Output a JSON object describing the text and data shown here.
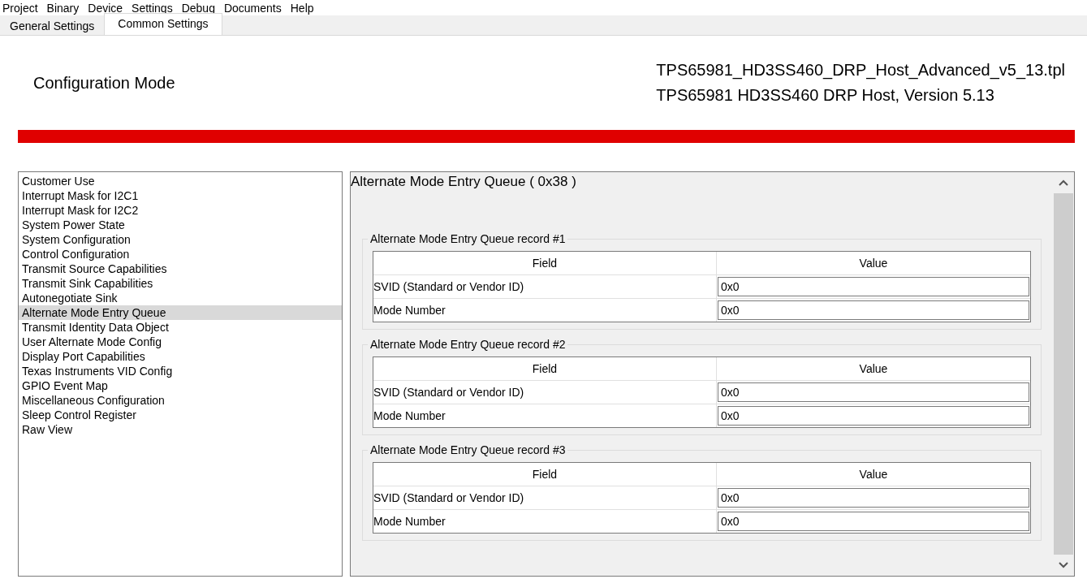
{
  "menu": [
    "Project",
    "Binary",
    "Device",
    "Settings",
    "Debug",
    "Documents",
    "Help"
  ],
  "tabs": [
    {
      "label": "General Settings",
      "selected": false
    },
    {
      "label": "Common Settings",
      "selected": true
    }
  ],
  "header": {
    "mode": "Configuration Mode",
    "file": "TPS65981_HD3SS460_DRP_Host_Advanced_v5_13.tpl",
    "description": "TPS65981 HD3SS460 DRP Host, Version 5.13"
  },
  "sidebar": {
    "items": [
      {
        "label": "Customer Use",
        "selected": false
      },
      {
        "label": "Interrupt Mask for I2C1",
        "selected": false
      },
      {
        "label": "Interrupt Mask for I2C2",
        "selected": false
      },
      {
        "label": "System Power State",
        "selected": false
      },
      {
        "label": "System Configuration",
        "selected": false
      },
      {
        "label": "Control Configuration",
        "selected": false
      },
      {
        "label": "Transmit Source Capabilities",
        "selected": false
      },
      {
        "label": "Transmit Sink Capabilities",
        "selected": false
      },
      {
        "label": "Autonegotiate Sink",
        "selected": false
      },
      {
        "label": "Alternate Mode Entry Queue",
        "selected": true
      },
      {
        "label": "Transmit Identity Data Object",
        "selected": false
      },
      {
        "label": "User Alternate Mode Config",
        "selected": false
      },
      {
        "label": "Display Port Capabilities",
        "selected": false
      },
      {
        "label": "Texas Instruments VID Config",
        "selected": false
      },
      {
        "label": "GPIO Event Map",
        "selected": false
      },
      {
        "label": "Miscellaneous Configuration",
        "selected": false
      },
      {
        "label": "Sleep Control Register",
        "selected": false
      },
      {
        "label": "Raw View",
        "selected": false
      }
    ]
  },
  "panel": {
    "title": "Alternate Mode Entry Queue  ( 0x38 )",
    "records": [
      {
        "title": "Alternate Mode Entry Queue record #1",
        "columns": [
          "Field",
          "Value"
        ],
        "rows": [
          {
            "field": "SVID (Standard or Vendor ID)",
            "value": "0x0"
          },
          {
            "field": "Mode Number",
            "value": "0x0"
          }
        ]
      },
      {
        "title": "Alternate Mode Entry Queue record #2",
        "columns": [
          "Field",
          "Value"
        ],
        "rows": [
          {
            "field": "SVID (Standard or Vendor ID)",
            "value": "0x0"
          },
          {
            "field": "Mode Number",
            "value": "0x0"
          }
        ]
      },
      {
        "title": "Alternate Mode Entry Queue record #3",
        "columns": [
          "Field",
          "Value"
        ],
        "rows": [
          {
            "field": "SVID (Standard or Vendor ID)",
            "value": "0x0"
          },
          {
            "field": "Mode Number",
            "value": "0x0"
          }
        ]
      }
    ]
  }
}
